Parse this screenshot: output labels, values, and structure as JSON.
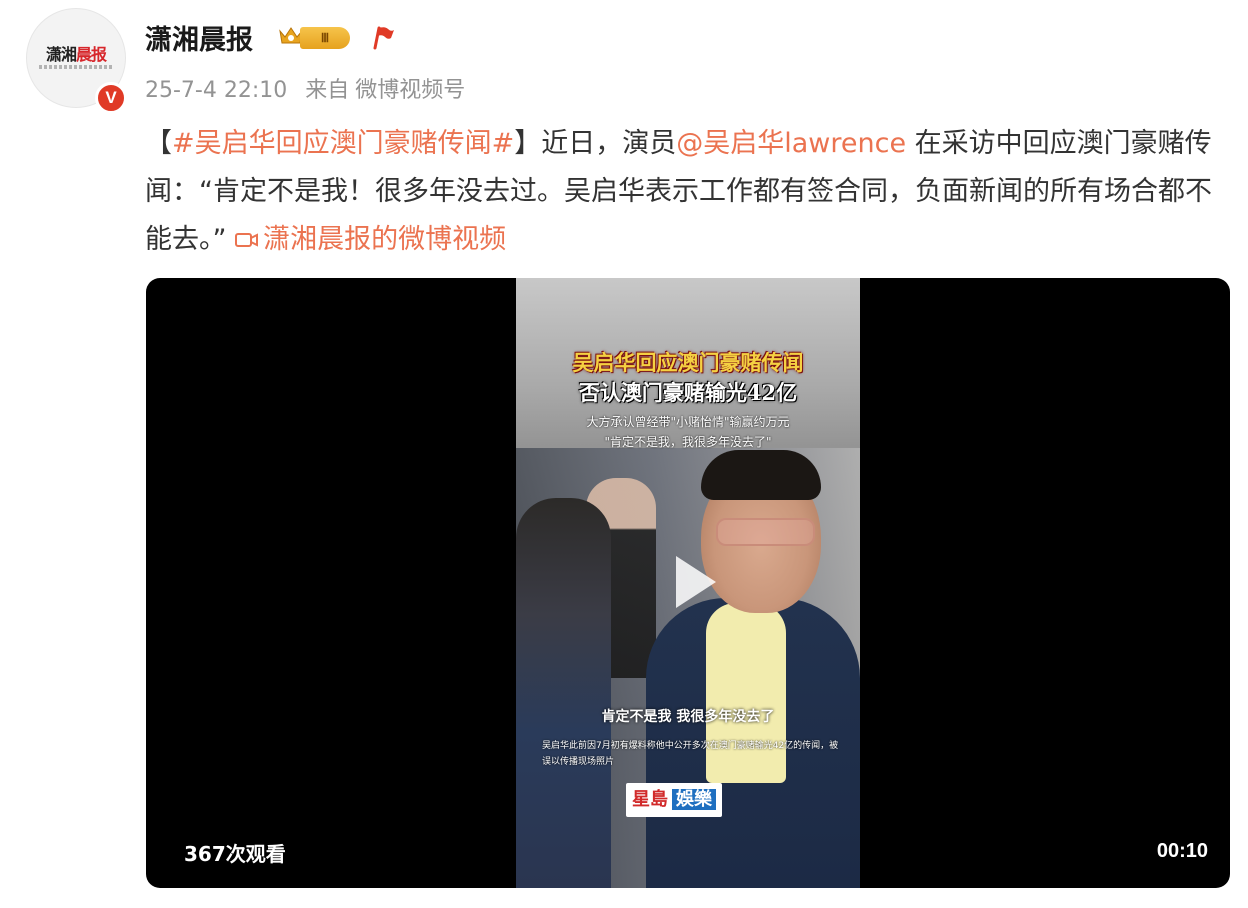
{
  "avatar": {
    "logo_black": "潇湘",
    "logo_red": "晨报",
    "verified_mark": "V"
  },
  "header": {
    "account_name": "潇湘晨报",
    "level_badge": "Ⅲ",
    "timestamp": "25-7-4 22:10",
    "source_prefix": "来自",
    "source_name": "微博视频号"
  },
  "post": {
    "bracket_open": "【",
    "hashtag": "#吴启华回应澳门豪赌传闻#",
    "bracket_close": "】",
    "text_before_mention": "近日，演员",
    "mention": "@吴启华lawrence",
    "text_after_mention": " 在采访中回应澳门豪赌传闻：“肯定不是我！很多年没去过。吴启华表示工作都有签合同，负面新闻的所有场合都不能去。” ",
    "video_link_label": "潇湘晨报的微博视频"
  },
  "video": {
    "overlay_title_line1": "吴启华回应澳门豪赌传闻",
    "overlay_title_line2": "否认澳门豪赌输光42亿",
    "overlay_sub_line1": "大方承认曾经带\"小赌怡情\"输赢约万元",
    "overlay_sub_line2": "\"肯定不是我，我很多年没去了\"",
    "caption": "肯定不是我 我很多年没去了",
    "note": "吴启华此前因7月初有爆料称他中公开多次在澳门豪赌输光42亿的传闻，被误以传播现场照片",
    "logo_main": "星島",
    "logo_side": "娛樂",
    "views": "367次观看",
    "duration": "00:10"
  },
  "colors": {
    "link": "#eb7350",
    "verified": "#e03a26",
    "badge": "#f6c44b"
  }
}
